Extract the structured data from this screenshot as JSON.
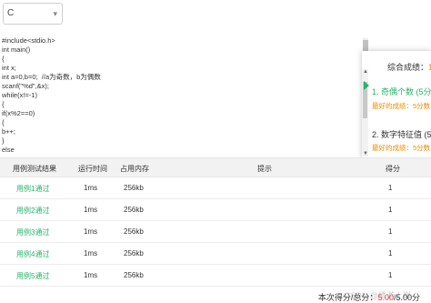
{
  "language_select": {
    "value": "C"
  },
  "code": {
    "lines": [
      "#include<stdio.h>",
      "int main()",
      "{",
      "int x;",
      "int a=0,b=0;  //a为奇数，b为偶数",
      "scanf(\"%d\",&x);",
      "while(x!=-1)",
      "{",
      "if(x%2==0)",
      "{",
      "b++;",
      "}",
      "else"
    ]
  },
  "right_panel": {
    "summary_label": "综合成绩：",
    "summary_value": "1",
    "items": [
      {
        "title": "1. 奇偶个数 (5分",
        "best": "最好的成绩：5分数",
        "active": true
      },
      {
        "title": "2. 数字特征值 (5分",
        "best": "最好的成绩：5分数",
        "active": false
      }
    ]
  },
  "table": {
    "headers": [
      "用例测试结果",
      "运行时间",
      "占用内存",
      "提示",
      "得分"
    ],
    "rows": [
      {
        "result": "用例1通过",
        "time": "1ms",
        "memory": "256kb",
        "hint": "",
        "score": "1"
      },
      {
        "result": "用例2通过",
        "time": "1ms",
        "memory": "256kb",
        "hint": "",
        "score": "1"
      },
      {
        "result": "用例3通过",
        "time": "1ms",
        "memory": "256kb",
        "hint": "",
        "score": "1"
      },
      {
        "result": "用例4通过",
        "time": "1ms",
        "memory": "256kb",
        "hint": "",
        "score": "1"
      },
      {
        "result": "用例5通过",
        "time": "1ms",
        "memory": "256kb",
        "hint": "",
        "score": "1"
      }
    ]
  },
  "footer": {
    "score_label": "本次得分/总分：",
    "score_value": "5.00",
    "score_total": "/5.00分",
    "watermark": "CSDN @橘游上岸"
  },
  "colors": {
    "pass_green": "#27b46a",
    "accent_orange": "#f08c00",
    "score_red": "#e53935"
  }
}
